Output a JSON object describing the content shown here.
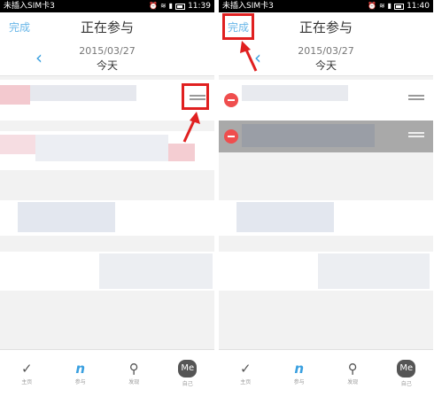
{
  "screens": [
    {
      "status": {
        "carrier": "未插入SIM卡3",
        "time": "11:39"
      },
      "nav": {
        "left": "完成",
        "title": "正在参与"
      },
      "date": {
        "date": "2015/03/27",
        "label": "今天"
      },
      "tabs": [
        {
          "icon": "✓",
          "label": "主页"
        },
        {
          "icon": "n",
          "label": "参与"
        },
        {
          "icon": "⚲",
          "label": "发现"
        },
        {
          "icon": "Me",
          "label": "自己"
        }
      ]
    },
    {
      "status": {
        "carrier": "未插入SIM卡3",
        "time": "11:40"
      },
      "nav": {
        "left": "完成",
        "title": "正在参与"
      },
      "date": {
        "date": "2015/03/27",
        "label": "今天"
      },
      "tabs": [
        {
          "icon": "✓",
          "label": "主页"
        },
        {
          "icon": "n",
          "label": "参与"
        },
        {
          "icon": "⚲",
          "label": "发现"
        },
        {
          "icon": "Me",
          "label": "自己"
        }
      ]
    }
  ],
  "icons": [
    "wifi-icon",
    "alarm-icon",
    "signal-icon",
    "battery-icon",
    "back-chevron-icon",
    "drag-handle-icon",
    "delete-minus-icon",
    "red-arrow-icon",
    "check-icon",
    "participate-icon",
    "location-pin-icon",
    "me-icon"
  ],
  "colors": {
    "accent": "#3aa0e0",
    "highlight": "#e02020",
    "delete": "#ef4e4e"
  }
}
